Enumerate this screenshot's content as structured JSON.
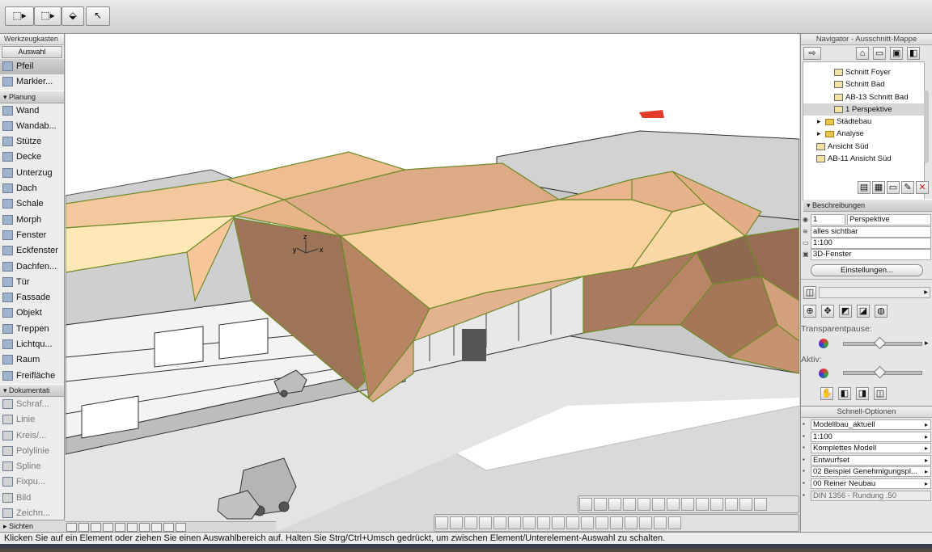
{
  "toolbar": {
    "buttons": [
      "select-arrow-dropdown",
      "marquee-dropdown",
      "fill-icon",
      "pointer-icon"
    ]
  },
  "toolbox": {
    "title": "Werkzeugkasten",
    "mode_label": "Auswahl",
    "items_selection": [
      {
        "label": "Pfeil",
        "icon": "arrow-icon"
      },
      {
        "label": "Markier...",
        "icon": "marquee-icon"
      }
    ],
    "section_planung": "Planung",
    "items_planung": [
      {
        "label": "Wand",
        "icon": "wall-icon"
      },
      {
        "label": "Wandab...",
        "icon": "wall-end-icon"
      },
      {
        "label": "Stütze",
        "icon": "column-icon"
      },
      {
        "label": "Decke",
        "icon": "slab-icon"
      },
      {
        "label": "Unterzug",
        "icon": "beam-icon"
      },
      {
        "label": "Dach",
        "icon": "roof-icon"
      },
      {
        "label": "Schale",
        "icon": "shell-icon"
      },
      {
        "label": "Morph",
        "icon": "morph-icon"
      },
      {
        "label": "Fenster",
        "icon": "window-icon"
      },
      {
        "label": "Eckfenster",
        "icon": "corner-window-icon"
      },
      {
        "label": "Dachfen...",
        "icon": "skylight-icon"
      },
      {
        "label": "Tür",
        "icon": "door-icon"
      },
      {
        "label": "Fassade",
        "icon": "facade-icon"
      },
      {
        "label": "Objekt",
        "icon": "object-icon"
      },
      {
        "label": "Treppen",
        "icon": "stairs-icon"
      },
      {
        "label": "Lichtqu...",
        "icon": "lamp-icon"
      },
      {
        "label": "Raum",
        "icon": "zone-icon"
      },
      {
        "label": "Freifläche",
        "icon": "mesh-icon"
      }
    ],
    "section_doku": "Dokumentati",
    "items_doku": [
      {
        "label": "Schraf...",
        "icon": "hatch-icon"
      },
      {
        "label": "Linie",
        "icon": "line-icon"
      },
      {
        "label": "Kreis/...",
        "icon": "circle-icon"
      },
      {
        "label": "Polylinie",
        "icon": "polyline-icon"
      },
      {
        "label": "Spline",
        "icon": "spline-icon"
      },
      {
        "label": "Fixpu...",
        "icon": "hotspot-icon"
      },
      {
        "label": "Bild",
        "icon": "figure-icon"
      },
      {
        "label": "Zeichn...",
        "icon": "drawing-icon"
      }
    ],
    "section_sichten": "Sichten"
  },
  "viewport": {
    "axis": {
      "z": "z",
      "y": "y",
      "x": "x"
    }
  },
  "navigator": {
    "title": "Navigator - Ausschnitt-Mappe",
    "tree": [
      {
        "label": "Schnitt Foyer",
        "icon": "view-icon",
        "indent": 2,
        "selected": false
      },
      {
        "label": "Schnitt Bad",
        "icon": "view-icon",
        "indent": 2,
        "selected": false
      },
      {
        "label": "AB-13 Schnitt Bad",
        "icon": "layout-icon",
        "indent": 2,
        "selected": false
      },
      {
        "label": "1 Perspektive",
        "icon": "camera-icon",
        "indent": 2,
        "selected": true
      },
      {
        "label": "Städtebau",
        "icon": "folder-icon",
        "indent": 1,
        "selected": false
      },
      {
        "label": "Analyse",
        "icon": "folder-icon",
        "indent": 1,
        "selected": false
      },
      {
        "label": "Ansicht Süd",
        "icon": "view-icon",
        "indent": 1,
        "selected": false
      },
      {
        "label": "AB-11 Ansicht Süd",
        "icon": "layout-icon",
        "indent": 1,
        "selected": false
      }
    ],
    "section_beschreibungen": "Beschreibungen",
    "fields": {
      "id": "1",
      "name": "Perspektive",
      "layers": "alles sichtbar",
      "scale": "1:100",
      "window": "3D-Fenster"
    },
    "settings_button": "Einstellungen...",
    "transparent_label": "Transparentpause:",
    "aktiv_label": "Aktiv:",
    "transparent_level": 0.47,
    "aktiv_level": 0.47
  },
  "quick_options": {
    "title": "Schnell-Optionen",
    "rows": [
      {
        "label": "Modellbau_aktuell",
        "icon": "layer-set-icon"
      },
      {
        "label": "1:100",
        "icon": "scale-icon"
      },
      {
        "label": "Komplettes Modell",
        "icon": "structure-icon"
      },
      {
        "label": "Entwurfset",
        "icon": "pen-set-icon"
      },
      {
        "label": "02 Beispiel Genehmigungspl...",
        "icon": "mvo-icon"
      },
      {
        "label": "00 Reiner Neubau",
        "icon": "renovation-icon"
      },
      {
        "label": "DIN 1356 - Rundung .50",
        "icon": "dimension-icon"
      }
    ]
  },
  "statusbar": {
    "text": "Klicken Sie auf ein Element oder ziehen Sie einen Auswahlbereich auf. Halten Sie Strg/Ctrl+Umsch gedrückt, um zwischen Element/Unterelement-Auswahl zu schalten."
  }
}
